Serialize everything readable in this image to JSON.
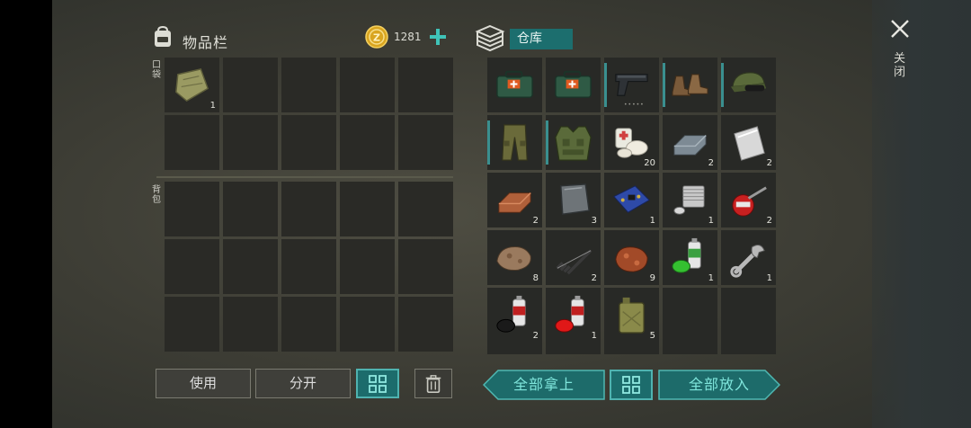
{
  "inventory": {
    "title": "物品栏",
    "coins": "1281",
    "pocket_label": "口袋",
    "backpack_label": "背包",
    "pocket_slots": [
      {
        "icon": "map-cloth-icon",
        "qty": "1"
      },
      {},
      {},
      {},
      {},
      {},
      {},
      {},
      {},
      {}
    ],
    "backpack_slots": 15
  },
  "stash": {
    "title": "仓库",
    "slots": [
      {
        "icon": "medkit-icon",
        "qty": "",
        "equip": false
      },
      {
        "icon": "medkit-icon",
        "qty": "",
        "equip": false
      },
      {
        "icon": "pistol-icon",
        "qty": "",
        "equip": true,
        "dots": "•••••"
      },
      {
        "icon": "boots-icon",
        "qty": "",
        "equip": true
      },
      {
        "icon": "cap-icon",
        "qty": "",
        "equip": true
      },
      {
        "icon": "pants-icon",
        "qty": "",
        "equip": true
      },
      {
        "icon": "vest-icon",
        "qty": "",
        "equip": true
      },
      {
        "icon": "bandage-icon",
        "qty": "20",
        "equip": false
      },
      {
        "icon": "iron-ingot-icon",
        "qty": "2",
        "equip": false
      },
      {
        "icon": "steel-plate-icon",
        "qty": "2",
        "equip": false
      },
      {
        "icon": "copper-ingot-icon",
        "qty": "2",
        "equip": false
      },
      {
        "icon": "metal-sheet-icon",
        "qty": "3",
        "equip": false
      },
      {
        "icon": "circuit-board-icon",
        "qty": "1",
        "equip": false
      },
      {
        "icon": "engine-part-icon",
        "qty": "1",
        "equip": false
      },
      {
        "icon": "oil-can-icon",
        "qty": "2",
        "equip": false
      },
      {
        "icon": "iron-ore-icon",
        "qty": "8",
        "equip": false
      },
      {
        "icon": "spring-icon",
        "qty": "2",
        "equip": false
      },
      {
        "icon": "copper-ore-icon",
        "qty": "9",
        "equip": false
      },
      {
        "icon": "green-spray-icon",
        "qty": "1",
        "equip": false
      },
      {
        "icon": "wrench-icon",
        "qty": "1",
        "equip": false
      },
      {
        "icon": "black-spray-icon",
        "qty": "2",
        "equip": false
      },
      {
        "icon": "red-spray-icon",
        "qty": "1",
        "equip": false
      },
      {
        "icon": "jerrycan-icon",
        "qty": "5",
        "equip": false
      },
      {
        "icon": "",
        "qty": "",
        "equip": false
      },
      {
        "icon": "",
        "qty": "",
        "equip": false
      }
    ]
  },
  "buttons": {
    "use": "使用",
    "split": "分开",
    "take_all": "全部拿上",
    "put_all": "全部放入"
  },
  "close": {
    "label": "关闭"
  },
  "colors": {
    "accent": "#1c6e6e",
    "accent_light": "#7fe6dc",
    "coin": "#d9a520"
  }
}
